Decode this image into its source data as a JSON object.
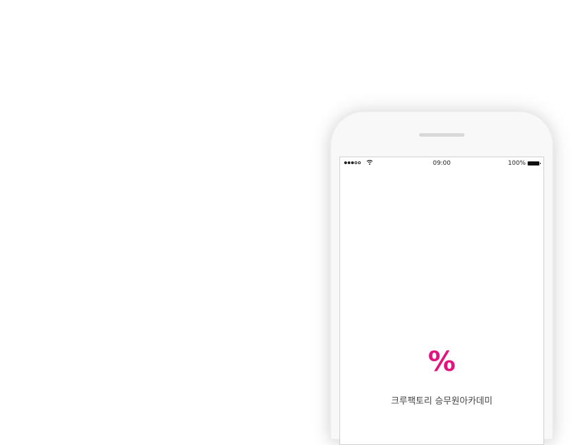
{
  "statusbar": {
    "signal_icon": "cellular-signal-icon",
    "signal_dots": 5,
    "signal_filled": 3,
    "wifi_icon": "wifi-icon",
    "time": "09:00",
    "battery_percent": "100%",
    "battery_icon": "battery-icon"
  },
  "splash": {
    "logo_symbol": "%",
    "app_name": "크루팩토리 승무원아카데미",
    "accent_color": "#e4127e"
  }
}
